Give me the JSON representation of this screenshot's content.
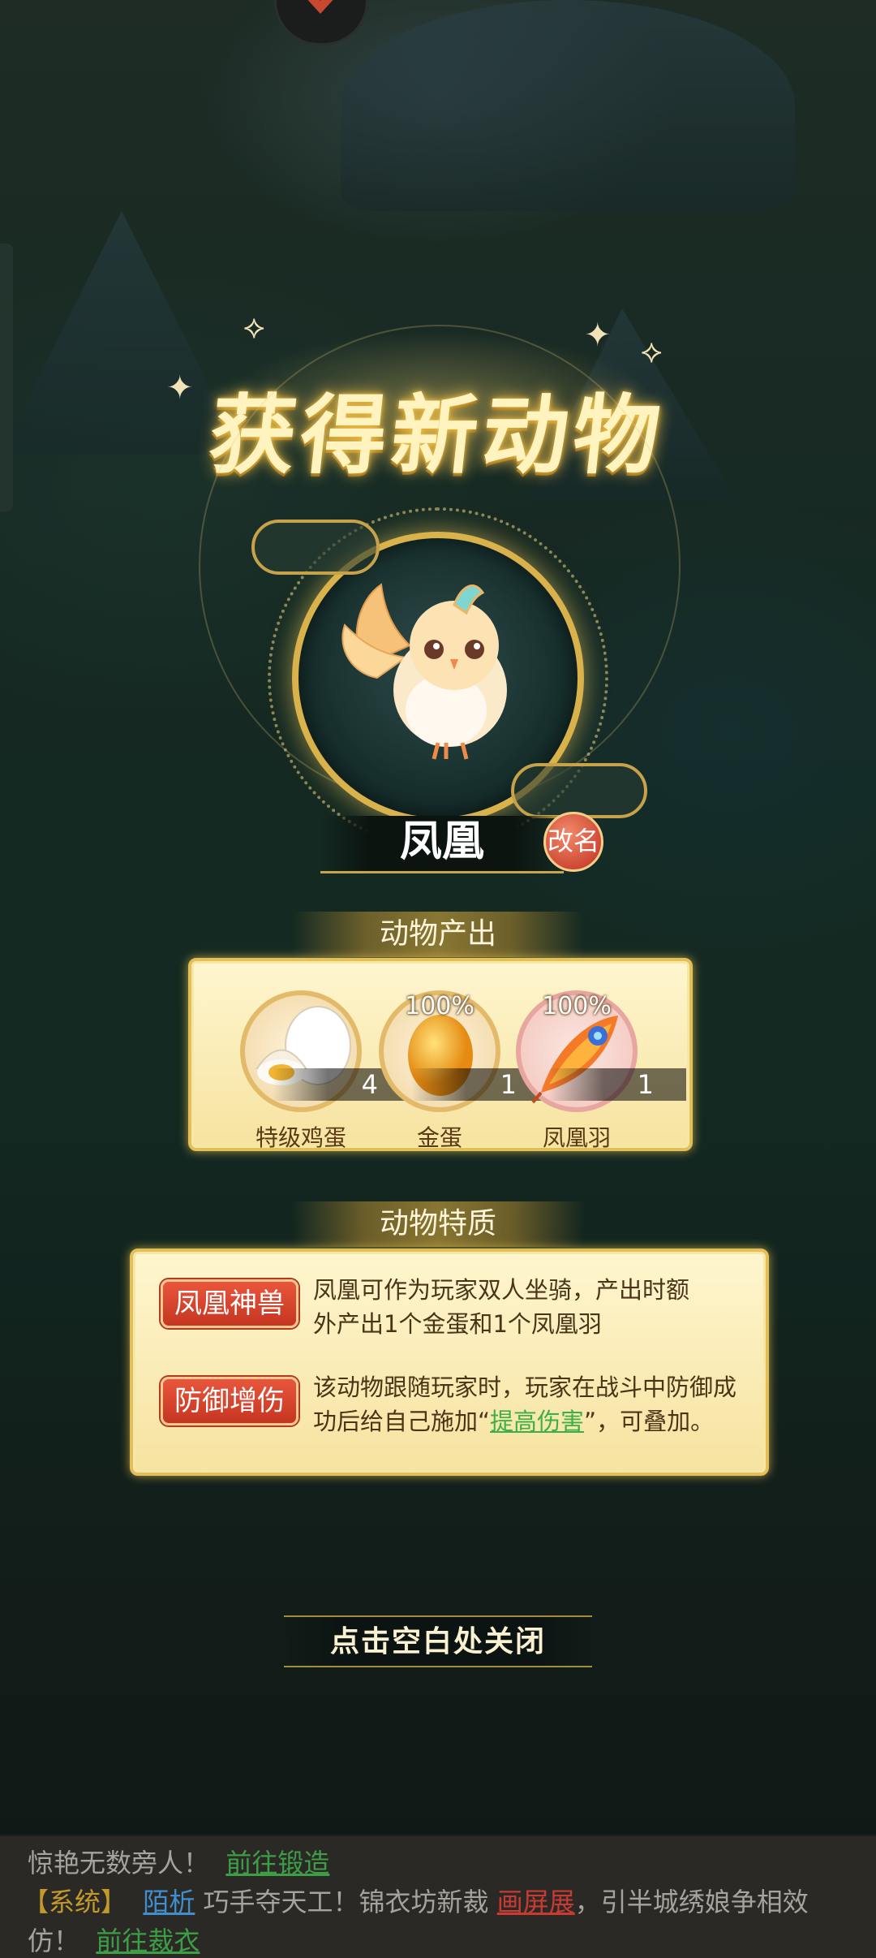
{
  "title": "获得新动物",
  "animal": {
    "name": "凤凰",
    "rename_label": "改名"
  },
  "produce": {
    "header": "动物产出",
    "items": [
      {
        "name": "特级鸡蛋",
        "quantity": "4",
        "percent": "",
        "icon": "chicken-egg-icon"
      },
      {
        "name": "金蛋",
        "quantity": "1",
        "percent": "100%",
        "icon": "golden-egg-icon"
      },
      {
        "name": "凤凰羽",
        "quantity": "1",
        "percent": "100%",
        "icon": "phoenix-feather-icon"
      }
    ]
  },
  "traits": {
    "header": "动物特质",
    "items": [
      {
        "tag": "凤凰神兽",
        "desc_line1": "凤凰可作为玩家双人坐骑，产出时额",
        "desc_line2": "外产出1个金蛋和1个凤凰羽"
      },
      {
        "tag": "防御增伤",
        "desc_line1": "该动物跟随玩家时，玩家在战斗中防御成",
        "desc_line2_pre": "功后给自己施加“",
        "desc_link": "提高伤害",
        "desc_line2_post": "”，可叠加。"
      }
    ]
  },
  "close_hint": "点击空白处关闭",
  "chat": {
    "line1_text": "惊艳无数旁人！",
    "line1_link": "前往锻造",
    "line2_tag": "【系统】",
    "line2_user": "陌析",
    "line2_text": "巧手夺天工！锦衣坊新裁",
    "line2_item": "画屏展",
    "line2_tail": "，引半城绣娘争相效",
    "line3_text": "仿！",
    "line3_link": "前往裁衣"
  },
  "colors": {
    "gold": "#d9b24b",
    "trait_red": "#c53520",
    "link_green": "#3bb04a",
    "panel_bg": "#fff6cf"
  }
}
